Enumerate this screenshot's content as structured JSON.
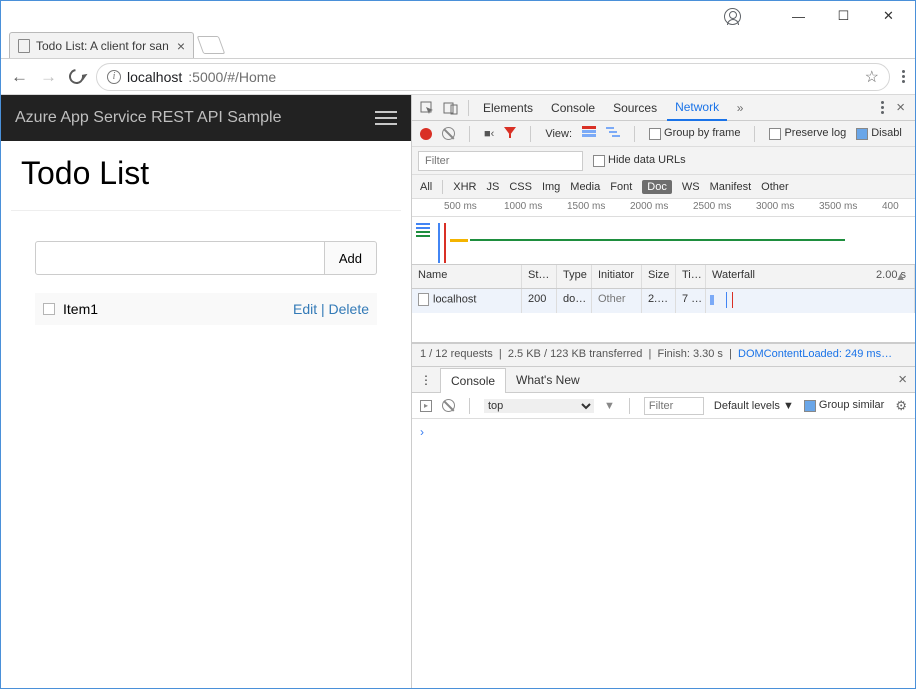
{
  "window": {
    "tab_title": "Todo List: A client for san"
  },
  "address": {
    "host": "localhost",
    "port_path": ":5000/#/Home"
  },
  "app": {
    "header": "Azure App Service REST API Sample",
    "title": "Todo List",
    "add_label": "Add",
    "items": [
      {
        "text": "Item1",
        "edit": "Edit",
        "delete": "Delete"
      }
    ]
  },
  "devtools": {
    "tabs": {
      "elements": "Elements",
      "console": "Console",
      "sources": "Sources",
      "network": "Network"
    },
    "toolbar": {
      "view_label": "View:",
      "group_frame": "Group by frame",
      "preserve_log": "Preserve log",
      "disable": "Disabl"
    },
    "filter_placeholder": "Filter",
    "hide_data_urls": "Hide data URLs",
    "types": {
      "all": "All",
      "xhr": "XHR",
      "js": "JS",
      "css": "CSS",
      "img": "Img",
      "media": "Media",
      "font": "Font",
      "doc": "Doc",
      "ws": "WS",
      "manifest": "Manifest",
      "other": "Other"
    },
    "ruler": [
      "500 ms",
      "1000 ms",
      "1500 ms",
      "2000 ms",
      "2500 ms",
      "3000 ms",
      "3500 ms",
      "400"
    ],
    "table": {
      "headers": {
        "name": "Name",
        "status": "St…",
        "type": "Type",
        "initiator": "Initiator",
        "size": "Size",
        "time": "Ti…",
        "waterfall": "Waterfall",
        "wf_time": "2.00 s"
      },
      "rows": [
        {
          "name": "localhost",
          "status": "200",
          "type": "do…",
          "initiator": "Other",
          "size": "2.…",
          "time": "7 …"
        }
      ]
    },
    "summary": {
      "requests": "1 / 12 requests",
      "transferred": "2.5 KB / 123 KB transferred",
      "finish": "Finish: 3.30 s",
      "dcl": "DOMContentLoaded: 249 ms…"
    },
    "drawer": {
      "console_tab": "Console",
      "whatsnew_tab": "What's New",
      "context": "top",
      "filter_placeholder": "Filter",
      "levels": "Default levels",
      "group_similar": "Group similar",
      "prompt": "›"
    }
  }
}
